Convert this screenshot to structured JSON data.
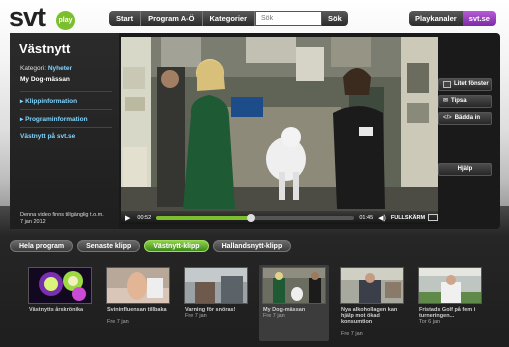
{
  "brand": {
    "logo_text": "svt",
    "play_text": "play"
  },
  "nav": {
    "start": "Start",
    "program": "Program A-Ö",
    "kategorier": "Kategorier",
    "search_placeholder": "Sök",
    "search_btn": "Sök",
    "playkanaler": "Playkanaler",
    "svtse": "svt.se"
  },
  "program": {
    "title": "Västnytt",
    "category_label": "Kategori:",
    "category_value": "Nyheter",
    "episode": "My Dog-mässan",
    "links": [
      "Klippinformation",
      "Programinformation"
    ],
    "site_link": "Västnytt på svt.se",
    "availability_1": "Denna video finns tillgänglig t.o.m.",
    "availability_2": "7 jan 2012"
  },
  "player": {
    "time_current": "00:52",
    "time_total": "01:45",
    "fullscreen": "FULLSKÄRM",
    "progress_fraction": 0.48
  },
  "side_buttons": {
    "list": "Litet fönster",
    "tipsa": "Tipsa",
    "embed": "Bädda in",
    "help": "Hjälp"
  },
  "tabs": [
    "Hela program",
    "Senaste klipp",
    "Västnytt-klipp",
    "Hallandsnytt-klipp"
  ],
  "active_tab": 2,
  "clips": [
    {
      "title": "Västnytts årskrönika",
      "date": ""
    },
    {
      "title": "Svininfluensan tillbaka",
      "date": "Fre 7 jan"
    },
    {
      "title": "Varning för snöras!",
      "date": "Fre 7 jan"
    },
    {
      "title": "My Dog-mässan",
      "date": "Fre 7 jan"
    },
    {
      "title": "Nya alkohollagen kan hjälp mot ökad konsumtion",
      "date": "Fre 7 jan"
    },
    {
      "title": "Fristads Golf på fem i turneringen...",
      "date": "Tor 6 jan"
    }
  ],
  "colors": {
    "accent_green": "#7bbf2e",
    "link_blue": "#7fd5ff",
    "svtse_purple": "#9a3fc4"
  }
}
